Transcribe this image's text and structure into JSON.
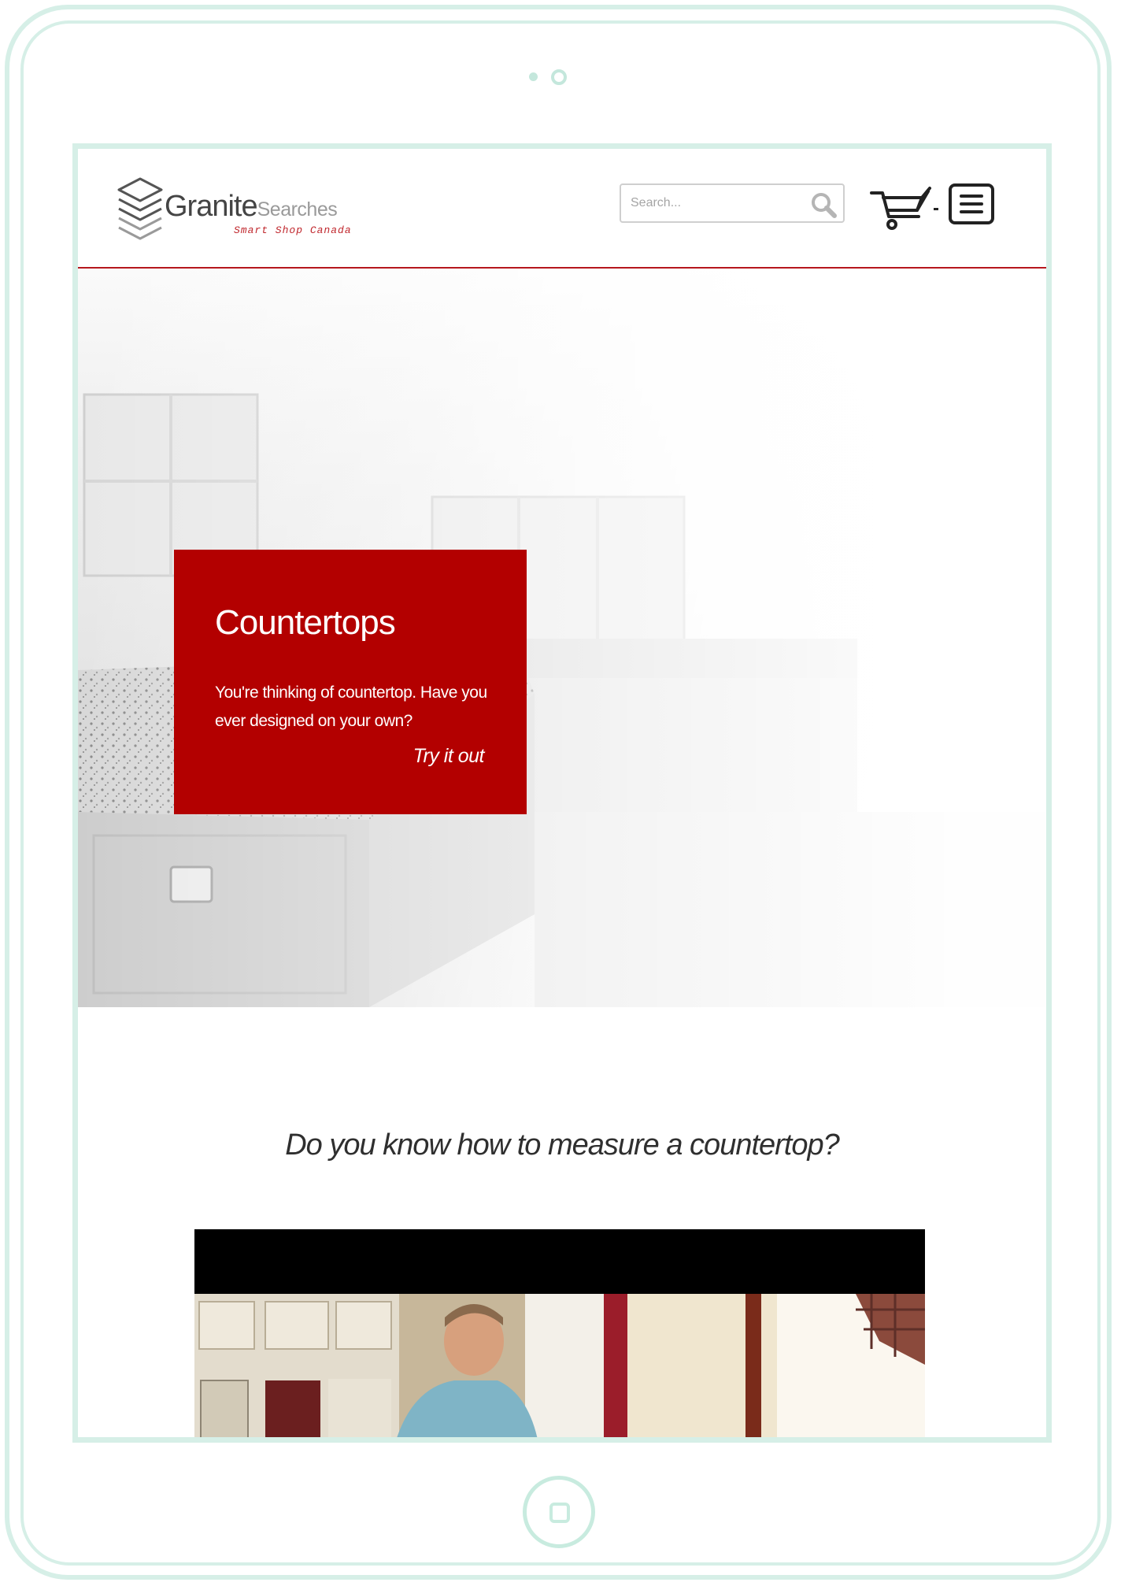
{
  "site": {
    "logo": {
      "name_main": "Granite",
      "name_sub": "Searches",
      "tagline": "Smart Shop Canada"
    },
    "search": {
      "placeholder": "Search..."
    },
    "icons": {
      "search": "search-icon",
      "cart": "cart-icon",
      "menu": "hamburger-menu-icon",
      "logo": "stacked-layers-icon"
    }
  },
  "hero": {
    "title": "Countertops",
    "text": "You're thinking of countertop. Have you ever designed on your own?",
    "cta": "Try it out"
  },
  "section": {
    "heading": "Do you know how to measure a countertop?"
  },
  "colors": {
    "brand_red": "#b30000",
    "header_rule": "#b6171d",
    "frame": "#d6efe7"
  }
}
